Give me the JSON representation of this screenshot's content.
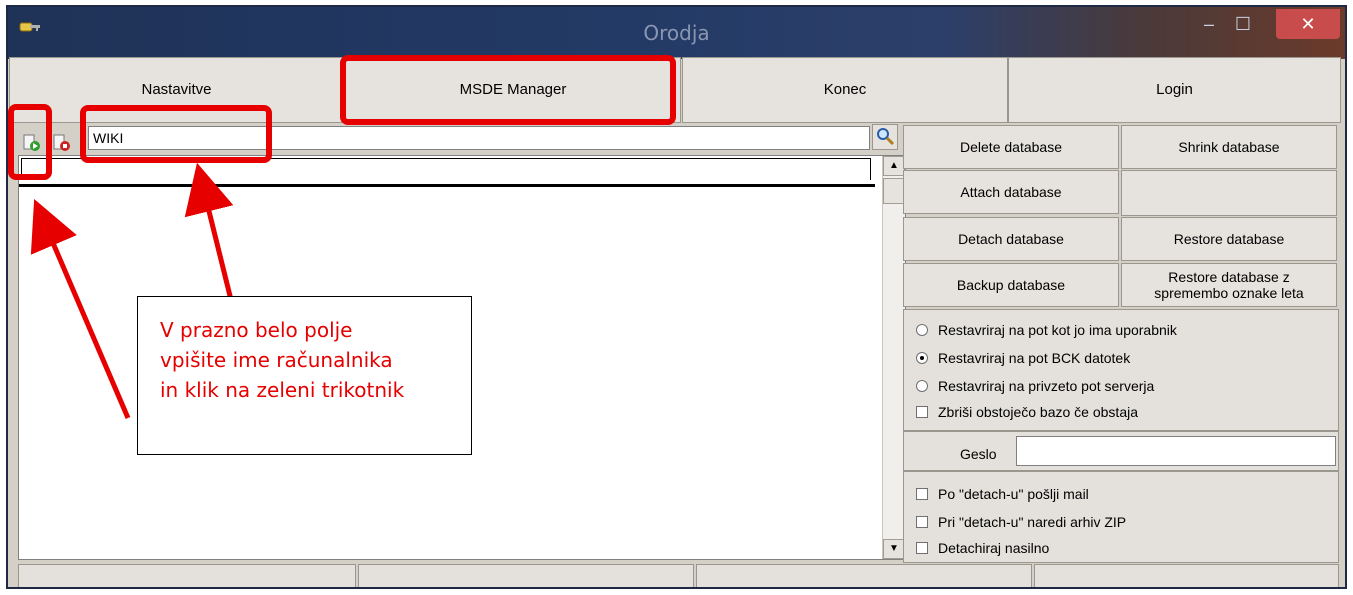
{
  "window": {
    "title": "Orodja",
    "minimize_glyph": "–",
    "maximize_glyph": "☐",
    "close_glyph": "✕"
  },
  "menu": {
    "items": [
      {
        "label": "Nastavitve"
      },
      {
        "label": "MSDE Manager"
      },
      {
        "label": "Konec"
      },
      {
        "label": "Login"
      }
    ]
  },
  "toolbar": {
    "server_value": "WIKI"
  },
  "actions": {
    "delete": "Delete database",
    "shrink": "Shrink database",
    "attach": "Attach database",
    "detach": "Detach database",
    "restore": "Restore database",
    "backup": "Backup database",
    "restore_year_line1": "Restore database z",
    "restore_year_line2": "spremembo oznake leta"
  },
  "restore_options": [
    {
      "label": "Restavriraj na pot kot jo ima uporabnik",
      "selected": false
    },
    {
      "label": "Restavriraj na pot BCK datotek",
      "selected": true
    },
    {
      "label": "Restavriraj na privzeto pot serverja",
      "selected": false
    }
  ],
  "delete_existing": {
    "label": "Zbriši obstoječo bazo če obstaja",
    "checked": false
  },
  "password": {
    "label": "Geslo",
    "value": ""
  },
  "detach_options": [
    {
      "label": "Po \"detach-u\" pošlji mail",
      "checked": false
    },
    {
      "label": "Pri \"detach-u\" naredi arhiv ZIP",
      "checked": false
    },
    {
      "label": "Detachiraj nasilno",
      "checked": false
    }
  ],
  "annotation": {
    "lines": [
      "V prazno belo polje",
      "vpišite ime računalnika",
      "in klik na zeleni trikotnik"
    ],
    "color": "#e60000"
  },
  "colors": {
    "titlebar": "#233a66",
    "button_face": "#e6e3de",
    "highlight": "#e60000"
  }
}
